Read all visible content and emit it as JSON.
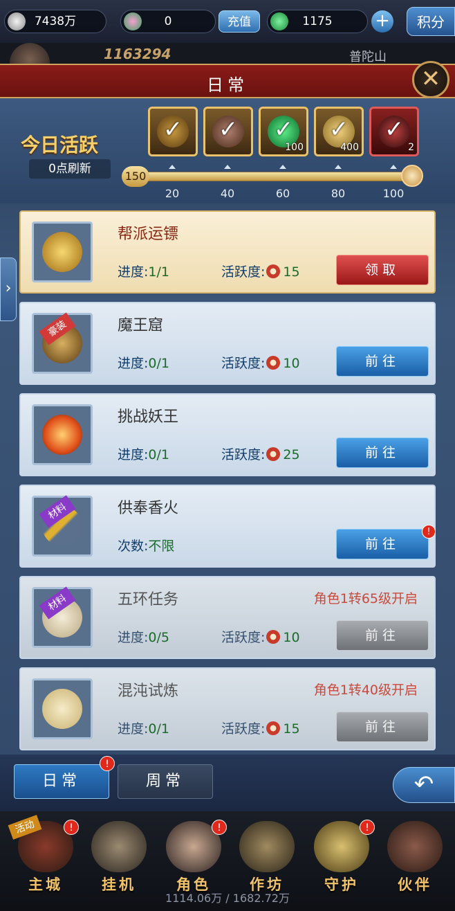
{
  "topbar": {
    "silver": "7438万",
    "gem": "0",
    "charge_label": "充值",
    "jade": "1175",
    "plus_label": "+",
    "points_label": "积分"
  },
  "player": {
    "power": "1163294",
    "location": "普陀山"
  },
  "dialog": {
    "title": "日常",
    "close_label": "✕"
  },
  "activity": {
    "title": "今日活跃",
    "refresh": "0点刷新",
    "current": "150",
    "max": 100,
    "progress_fraction": 1.0,
    "rewards": [
      {
        "claimed": true,
        "count": ""
      },
      {
        "claimed": true,
        "count": ""
      },
      {
        "claimed": true,
        "count": "100"
      },
      {
        "claimed": true,
        "count": "400"
      },
      {
        "claimed": true,
        "count": "2"
      }
    ],
    "ticks": [
      "20",
      "40",
      "60",
      "80",
      "100"
    ]
  },
  "tasks": [
    {
      "name": "帮派运镖",
      "tag": "",
      "progress_label": "进度:",
      "progress": "1/1",
      "activity_label": "活跃度:",
      "activity": "15",
      "button": "领取",
      "button_style": "red",
      "unlock": "",
      "badge": ""
    },
    {
      "name": "魔王窟",
      "tag": "豪装",
      "progress_label": "进度:",
      "progress": "0/1",
      "activity_label": "活跃度:",
      "activity": "10",
      "button": "前往",
      "button_style": "blue",
      "unlock": "",
      "badge": ""
    },
    {
      "name": "挑战妖王",
      "tag": "",
      "progress_label": "进度:",
      "progress": "0/1",
      "activity_label": "活跃度:",
      "activity": "25",
      "button": "前往",
      "button_style": "blue",
      "unlock": "",
      "badge": ""
    },
    {
      "name": "供奉香火",
      "tag": "材料",
      "progress_label": "次数:",
      "progress": "不限",
      "activity_label": "",
      "activity": "",
      "button": "前往",
      "button_style": "blue",
      "unlock": "",
      "badge": "!"
    },
    {
      "name": "五环任务",
      "tag": "材料",
      "progress_label": "进度:",
      "progress": "0/5",
      "activity_label": "活跃度:",
      "activity": "10",
      "button": "前往",
      "button_style": "gray",
      "unlock": "角色1转65级开启",
      "badge": ""
    },
    {
      "name": "混沌试炼",
      "tag": "",
      "progress_label": "进度:",
      "progress": "0/1",
      "activity_label": "活跃度:",
      "activity": "15",
      "button": "前往",
      "button_style": "gray",
      "unlock": "角色1转40级开启",
      "badge": ""
    }
  ],
  "tabs": {
    "daily": "日常",
    "weekly": "周常",
    "daily_badge": "!"
  },
  "nav": [
    {
      "label": "主城",
      "badge": "!",
      "tag": "活动"
    },
    {
      "label": "挂机",
      "badge": "",
      "tag": ""
    },
    {
      "label": "角色",
      "badge": "!",
      "tag": ""
    },
    {
      "label": "作坊",
      "badge": "",
      "tag": ""
    },
    {
      "label": "守护",
      "badge": "!",
      "tag": ""
    },
    {
      "label": "伙伴",
      "badge": "",
      "tag": ""
    }
  ],
  "footer": "1114.06万 / 1682.72万",
  "colors": {
    "banner": "#8a1b18",
    "gold": "#f8d06a",
    "blue_button": "#2e7ac4",
    "red_button": "#c03030"
  }
}
